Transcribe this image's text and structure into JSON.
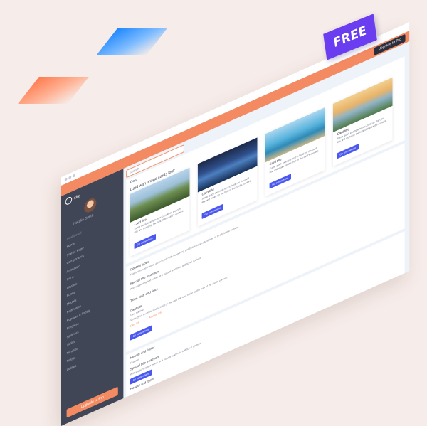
{
  "ribbon": {
    "label": "FREE"
  },
  "header": {
    "upgrade_label": "Upgrade to Pro"
  },
  "sidebar": {
    "brand": "site",
    "user_name": "Natalie Smith",
    "items": [
      {
        "label": "Dashboard",
        "heading": true
      },
      {
        "label": "Home"
      },
      {
        "label": "Starter Page"
      },
      {
        "label": "Components"
      },
      {
        "label": "Animation"
      },
      {
        "label": "Icons"
      },
      {
        "label": "Layouts"
      },
      {
        "label": "Forms"
      },
      {
        "label": "Modals"
      },
      {
        "label": "Pagination"
      },
      {
        "label": "Popover & Tooltip"
      },
      {
        "label": "Progress"
      },
      {
        "label": "Spinners"
      },
      {
        "label": "Tables"
      },
      {
        "label": "Timeline"
      },
      {
        "label": "Toasts"
      },
      {
        "label": "Utilities"
      }
    ],
    "upgrade_label": "Upgrade to Pro"
  },
  "main": {
    "search_placeholder": "Search",
    "section_title": "Card",
    "subsection_title": "Card with image cards look",
    "cards": [
      {
        "title": "Card title",
        "text": "Some quick example text to build on the card title and make up the bulk of the card's content.",
        "button": "Go somewhere",
        "image": "landscape-hill"
      },
      {
        "title": "Card title",
        "text": "Some quick example text to build on the card title and make up the bulk of the card's content.",
        "button": "Go somewhere",
        "image": "mountain-lake"
      },
      {
        "title": "Card title",
        "text": "Some quick example text to build on the card title and make up the bulk of the card's content.",
        "button": "Go somewhere",
        "image": "island-coast"
      },
      {
        "title": "Card title",
        "text": "Some quick example text to build on the card title and make up the bulk of the card's content.",
        "button": "Go somewhere",
        "image": "sunset-shore"
      }
    ],
    "content_types": {
      "title": "Content types",
      "text": "This is some text within a card body with supporting text below as a natural lead-in to additional content.",
      "special_title": "Special title treatment",
      "special_text": "With supporting text below as a natural lead-in to additional content.",
      "special_button": "Go somewhere",
      "titles_title": "Titles, text, and links",
      "card_title": "Card title",
      "card_subtitle": "Card subtitle",
      "card_text": "Some quick example text to build on the card title and make up the bulk of the card's content.",
      "links": [
        "Card link",
        "Another link"
      ]
    },
    "header_footer": {
      "title": "Header and footer",
      "featured": "Featured",
      "special_title": "Special title treatment",
      "special_text": "With supporting text below as a natural lead-in to additional content.",
      "button": "Go somewhere",
      "title2": "Header and footer"
    }
  },
  "colors": {
    "accent": "#f48a61",
    "primary": "#4b58f0",
    "sidebar": "#404656",
    "ribbon": "#6a3df0"
  }
}
